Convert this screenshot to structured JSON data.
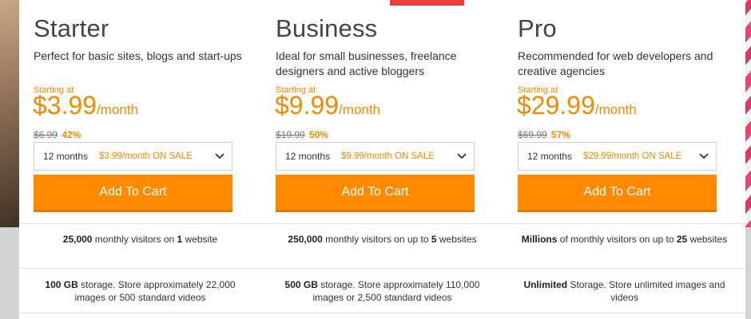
{
  "colors": {
    "accent": "#ff8a00",
    "price": "#f08a00",
    "ribbon": "#ea3e3e"
  },
  "plans": [
    {
      "name": "Starter",
      "description": "Perfect for basic sites, blogs and start-ups",
      "starting_label": "Starting at",
      "price": "$3.99",
      "period": "/month",
      "old_price": "$6.99",
      "discount": "42%",
      "term": "12 months",
      "term_sale": "$3.99/month ON SALE",
      "cta": "Add To Cart",
      "feature1": {
        "bold_a": "25,000",
        "text_a": " monthly visitors on ",
        "bold_b": "1",
        "text_b": " website"
      },
      "feature2": {
        "bold": "100 GB",
        "text": " storage. Store approximately 22,000 images or 500 standard videos"
      }
    },
    {
      "name": "Business",
      "description": "Ideal for small businesses, freelance designers and active bloggers",
      "starting_label": "Starting at",
      "price": "$9.99",
      "period": "/month",
      "old_price": "$19.99",
      "discount": "50%",
      "term": "12 months",
      "term_sale": "$9.99/month ON SALE",
      "cta": "Add To Cart",
      "feature1": {
        "bold_a": "250,000",
        "text_a": " monthly visitors on up to ",
        "bold_b": "5",
        "text_b": " websites"
      },
      "feature2": {
        "bold": "500 GB",
        "text": " storage. Store approximately 110,000 images or 2,500 standard videos"
      }
    },
    {
      "name": "Pro",
      "description": "Recommended for web developers and creative agencies",
      "starting_label": "Starting at",
      "price": "$29.99",
      "period": "/month",
      "old_price": "$69.99",
      "discount": "57%",
      "term": "12 months",
      "term_sale": "$29.99/month ON SALE",
      "cta": "Add To Cart",
      "feature1": {
        "bold_a": "Millions",
        "text_a": " of monthly visitors on up to ",
        "bold_b": "25",
        "text_b": " websites"
      },
      "feature2": {
        "bold": "Unlimited",
        "text": " Storage. Store unlimited images and videos"
      }
    }
  ]
}
